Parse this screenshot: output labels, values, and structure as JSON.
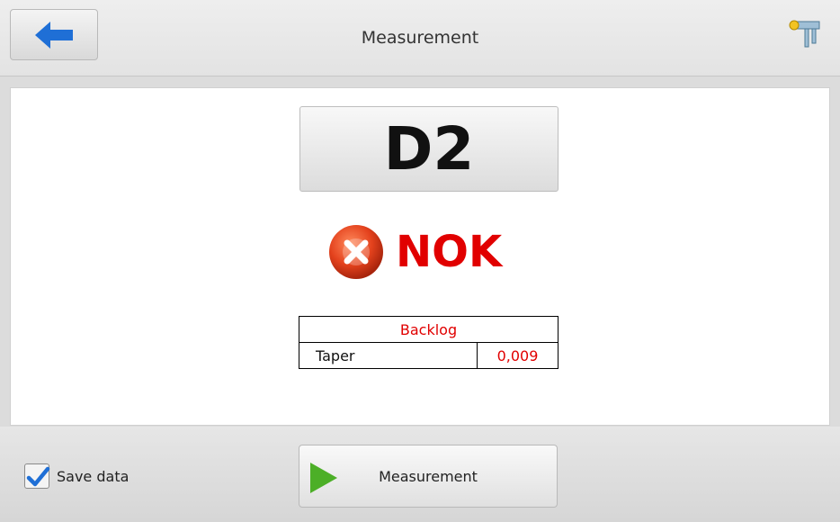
{
  "header": {
    "title": "Measurement",
    "back_icon": "arrow-left-icon",
    "tool_icon": "caliper-icon"
  },
  "main": {
    "feature_label": "D2",
    "result": {
      "icon": "error-x-icon",
      "text": "NOK",
      "color": "#e10000"
    },
    "backlog": {
      "header": "Backlog",
      "rows": [
        {
          "name": "Taper",
          "value": "0,009"
        }
      ]
    }
  },
  "footer": {
    "save_data": {
      "label": "Save data",
      "checked": true
    },
    "measure_button": {
      "label": "Measurement",
      "icon": "play-icon"
    }
  },
  "colors": {
    "accent_blue": "#1f6fd6",
    "nok_red": "#e10000",
    "play_green": "#4caf27"
  }
}
